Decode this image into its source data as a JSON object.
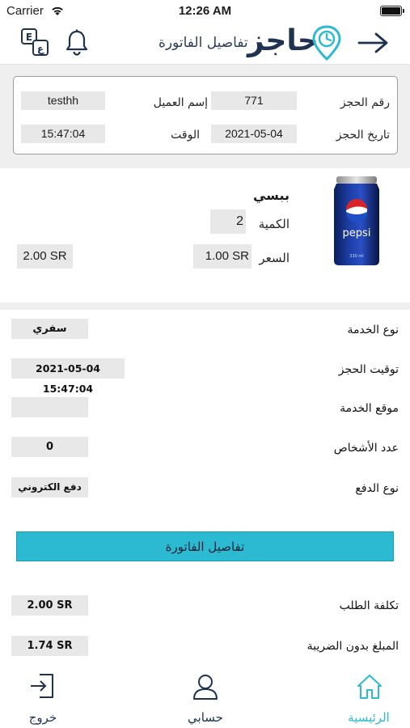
{
  "status_bar": {
    "carrier": "Carrier",
    "time": "12:26 AM"
  },
  "header": {
    "title": "تفاصيل الفاتورة",
    "logo_text": "حاجز",
    "accent_color": "#2bbad1",
    "icons": [
      "translate-icon",
      "bell-icon",
      "arrow-right-icon"
    ]
  },
  "booking_info": {
    "booking_number_label": "رقم الحجز",
    "booking_number": "771",
    "customer_name_label": "إسم العميل",
    "customer_name": "testhh",
    "booking_date_label": "تاريخ الحجز",
    "booking_date": "2021-05-04",
    "time_label": "الوقت",
    "time": "15:47:04"
  },
  "product": {
    "name": "ببسي",
    "quantity_label": "الكمية",
    "quantity": "2",
    "price_label": "السعر",
    "price": "1.00 SR",
    "total": "2.00 SR"
  },
  "details": [
    {
      "label": "نوع الخدمة",
      "value": "سفري"
    },
    {
      "label": "توقيت الحجز",
      "value": "2021-05-04 15:47:04"
    },
    {
      "label": "موقع الخدمة",
      "value": ""
    },
    {
      "label": "عدد الأشخاص",
      "value": "0"
    },
    {
      "label": "نوع الدفع",
      "value": "دفع الكتروني"
    }
  ],
  "invoice_button_label": "تفاصيل الفاتورة",
  "summary": [
    {
      "label": "تكلفة الطلب",
      "value": "2.00 SR"
    },
    {
      "label": "المبلغ بدون الضريبة",
      "value": "1.74 SR"
    }
  ],
  "tabbar": {
    "home": "الرئيسية",
    "account": "حسابي",
    "logout": "خروج",
    "active_color": "#2bbad1"
  }
}
